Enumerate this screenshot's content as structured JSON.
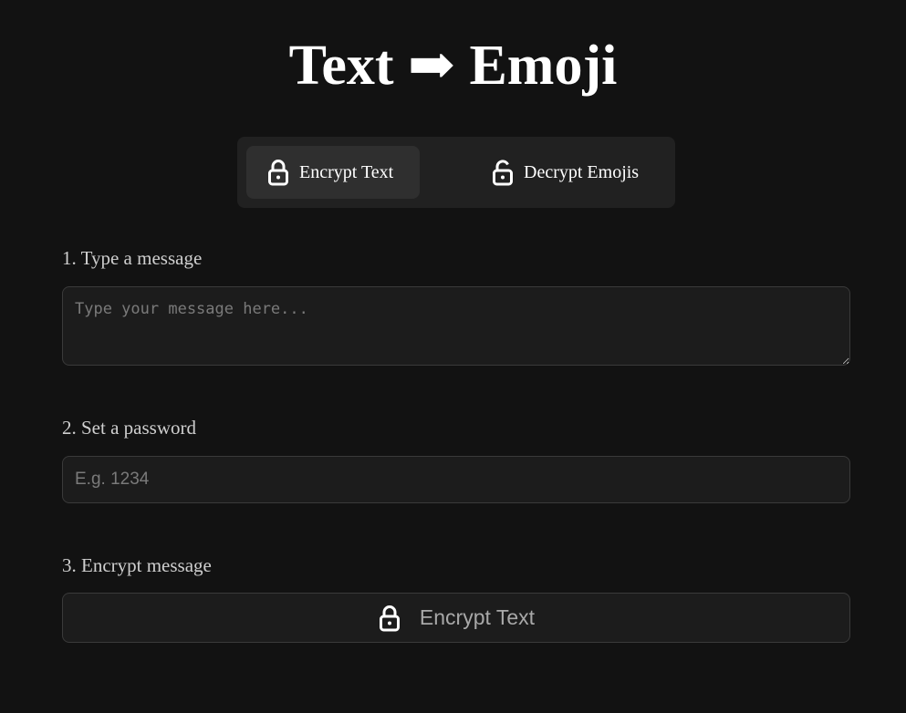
{
  "header": {
    "title": "Text ➡ Emoji"
  },
  "tabs": [
    {
      "label": "Encrypt Text",
      "icon": "lock-icon",
      "active": true
    },
    {
      "label": "Decrypt Emojis",
      "icon": "lock-open-icon",
      "active": false
    }
  ],
  "form": {
    "step1_label": "1. Type a message",
    "message_placeholder": "Type your message here...",
    "message_value": "",
    "step2_label": "2. Set a password",
    "password_placeholder": "E.g. 1234",
    "password_value": "",
    "step3_label": "3. Encrypt message",
    "submit_label": "Encrypt Text",
    "submit_icon": "lock-icon"
  },
  "colors": {
    "background": "#121212",
    "panel": "#212121",
    "active_tab": "#2f2f2f",
    "input_bg": "#1c1c1c",
    "border": "#3a3a3a"
  }
}
